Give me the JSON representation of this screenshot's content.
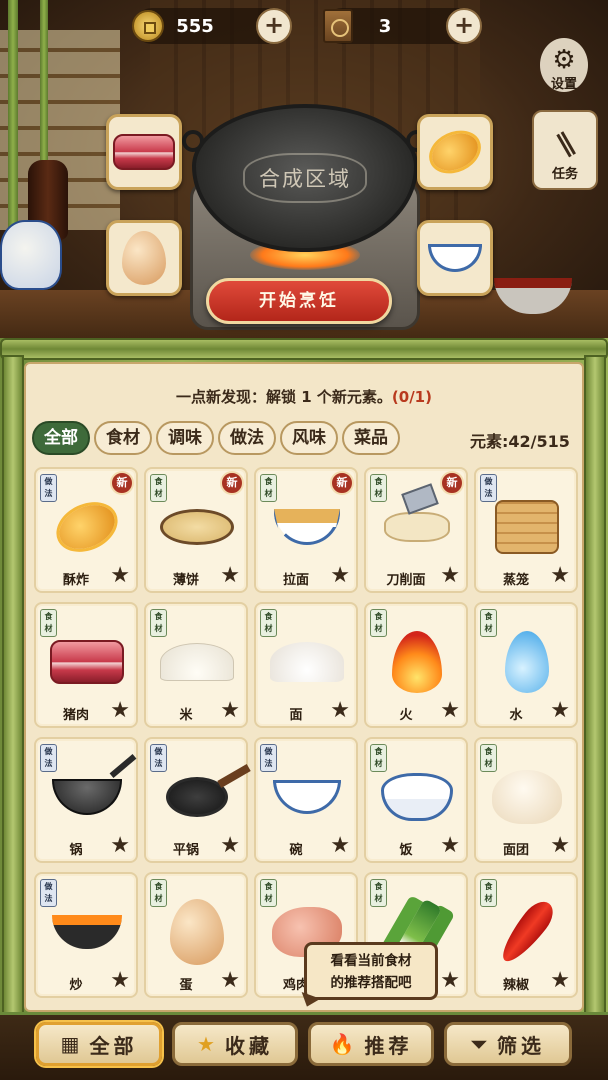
{
  "resources": {
    "coins": {
      "value": "555",
      "icon": "coin-icon"
    },
    "recipe_books": {
      "value": "3",
      "icon": "book-icon"
    },
    "add_symbol": "+"
  },
  "side_buttons": {
    "settings": {
      "label": "设置",
      "icon": "gear-icon"
    },
    "tasks": {
      "label": "任务",
      "icon": "chopsticks-icon"
    }
  },
  "cooking": {
    "wok_label": "合成区域",
    "start_button": "开始烹饪",
    "input_slots": [
      "猪肉",
      "蛋",
      "酥炸",
      "碗"
    ]
  },
  "discovery": {
    "text": "一点新发现：解锁 1 个新元素。",
    "progress": "(0/1)"
  },
  "category_tabs": [
    {
      "label": "全部",
      "active": true
    },
    {
      "label": "食材",
      "active": false
    },
    {
      "label": "调味",
      "active": false
    },
    {
      "label": "做法",
      "active": false
    },
    {
      "label": "风味",
      "active": false
    },
    {
      "label": "菜品",
      "active": false
    }
  ],
  "element_count": "元素:42/515",
  "items": [
    {
      "name": "酥炸",
      "tag": "做法",
      "new": true,
      "art": "fried"
    },
    {
      "name": "薄饼",
      "tag": "食材",
      "new": true,
      "art": "crepe"
    },
    {
      "name": "拉面",
      "tag": "食材",
      "new": true,
      "art": "noodle"
    },
    {
      "name": "刀削面",
      "tag": "食材",
      "new": true,
      "art": "knife"
    },
    {
      "name": "蒸笼",
      "tag": "做法",
      "new": false,
      "art": "steamer"
    },
    {
      "name": "猪肉",
      "tag": "食材",
      "new": false,
      "art": "pork"
    },
    {
      "name": "米",
      "tag": "食材",
      "new": false,
      "art": "rice"
    },
    {
      "name": "面",
      "tag": "食材",
      "new": false,
      "art": "flour"
    },
    {
      "name": "火",
      "tag": "食材",
      "new": false,
      "art": "fire"
    },
    {
      "name": "水",
      "tag": "食材",
      "new": false,
      "art": "water"
    },
    {
      "name": "锅",
      "tag": "做法",
      "new": false,
      "art": "wok"
    },
    {
      "name": "平锅",
      "tag": "做法",
      "new": false,
      "art": "pan"
    },
    {
      "name": "碗",
      "tag": "做法",
      "new": false,
      "art": "bowl"
    },
    {
      "name": "饭",
      "tag": "食材",
      "new": false,
      "art": "ricebowl"
    },
    {
      "name": "面团",
      "tag": "食材",
      "new": false,
      "art": "dough"
    },
    {
      "name": "炒",
      "tag": "做法",
      "new": false,
      "art": "stirfry"
    },
    {
      "name": "蛋",
      "tag": "食材",
      "new": false,
      "art": "egg"
    },
    {
      "name": "鸡肉",
      "tag": "食材",
      "new": false,
      "art": "chicken"
    },
    {
      "name": "",
      "tag": "食材",
      "new": false,
      "art": "onion"
    },
    {
      "name": "辣椒",
      "tag": "食材",
      "new": false,
      "art": "chili"
    }
  ],
  "new_badge": "新",
  "star_symbol": "★",
  "tooltip": {
    "line1": "看看当前食材",
    "line2": "的推荐搭配吧"
  },
  "bottom_nav": [
    {
      "label": "全部",
      "icon": "grid-icon",
      "glyph": "▦",
      "active": true
    },
    {
      "label": "收藏",
      "icon": "star-icon",
      "glyph": "★",
      "active": false
    },
    {
      "label": "推荐",
      "icon": "flame-icon",
      "glyph": "🔥",
      "active": false
    },
    {
      "label": "筛选",
      "icon": "filter-icon",
      "glyph": "⏷",
      "active": false
    }
  ]
}
